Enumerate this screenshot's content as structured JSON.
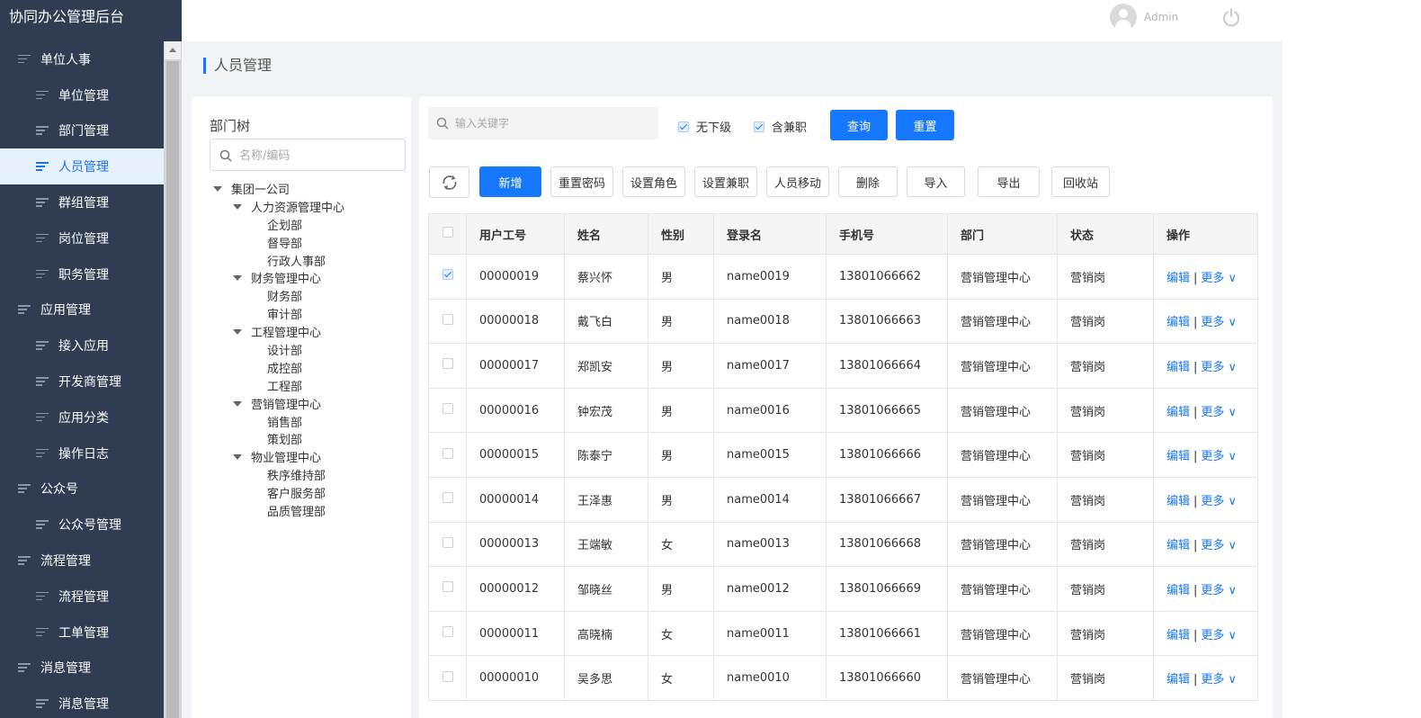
{
  "app": {
    "title": "协同办公管理后台",
    "user": "Admin"
  },
  "sidebar": {
    "items": [
      {
        "label": "单位人事",
        "level": "group"
      },
      {
        "label": "单位管理",
        "level": "sub"
      },
      {
        "label": "部门管理",
        "level": "sub"
      },
      {
        "label": "人员管理",
        "level": "sub",
        "active": true
      },
      {
        "label": "群组管理",
        "level": "sub"
      },
      {
        "label": "岗位管理",
        "level": "sub"
      },
      {
        "label": "职务管理",
        "level": "sub"
      },
      {
        "label": "应用管理",
        "level": "group"
      },
      {
        "label": "接入应用",
        "level": "sub"
      },
      {
        "label": "开发商管理",
        "level": "sub"
      },
      {
        "label": "应用分类",
        "level": "sub"
      },
      {
        "label": "操作日志",
        "level": "sub"
      },
      {
        "label": "公众号",
        "level": "group"
      },
      {
        "label": "公众号管理",
        "level": "sub"
      },
      {
        "label": "流程管理",
        "level": "group"
      },
      {
        "label": "流程管理",
        "level": "sub"
      },
      {
        "label": "工单管理",
        "level": "sub"
      },
      {
        "label": "消息管理",
        "level": "group"
      },
      {
        "label": "消息管理",
        "level": "sub"
      }
    ]
  },
  "page": {
    "title": "人员管理"
  },
  "tree": {
    "title": "部门树",
    "search_placeholder": "名称/编码",
    "nodes": [
      {
        "label": "集团一公司",
        "level": 1,
        "expanded": true
      },
      {
        "label": "人力资源管理中心",
        "level": 2,
        "expanded": true
      },
      {
        "label": "企划部",
        "level": 3
      },
      {
        "label": "督导部",
        "level": 3
      },
      {
        "label": "行政人事部",
        "level": 3
      },
      {
        "label": "财务管理中心",
        "level": 2,
        "expanded": true
      },
      {
        "label": "财务部",
        "level": 3
      },
      {
        "label": "审计部",
        "level": 3
      },
      {
        "label": "工程管理中心",
        "level": 2,
        "expanded": true
      },
      {
        "label": "设计部",
        "level": 3
      },
      {
        "label": "成控部",
        "level": 3
      },
      {
        "label": "工程部",
        "level": 3
      },
      {
        "label": "营销管理中心",
        "level": 2,
        "expanded": true
      },
      {
        "label": "销售部",
        "level": 3
      },
      {
        "label": "策划部",
        "level": 3
      },
      {
        "label": "物业管理中心",
        "level": 2,
        "expanded": true
      },
      {
        "label": "秩序维持部",
        "level": 3
      },
      {
        "label": "客户服务部",
        "level": 3
      },
      {
        "label": "品质管理部",
        "level": 3
      }
    ]
  },
  "filters": {
    "keyword_placeholder": "输入关键字",
    "no_sublevel": {
      "label": "无下级",
      "checked": true
    },
    "include_parttime": {
      "label": "含兼职",
      "checked": true
    },
    "query_label": "查询",
    "reset_label": "重置"
  },
  "toolbar": {
    "add": "新增",
    "reset_password": "重置密码",
    "set_role": "设置角色",
    "set_parttime": "设置兼职",
    "move": "人员移动",
    "delete": "删除",
    "import": "导入",
    "export": "导出",
    "recycle": "回收站"
  },
  "table": {
    "headers": [
      "用户工号",
      "姓名",
      "性别",
      "登录名",
      "手机号",
      "部门",
      "状态",
      "操作"
    ],
    "edit_label": "编辑",
    "more_label": "更多 ∨",
    "rows": [
      {
        "id": "00000019",
        "name": "蔡兴怀",
        "gender": "男",
        "login": "name0019",
        "phone": "13801066662",
        "dept": "营销管理中心",
        "status": "营销岗",
        "checked": true
      },
      {
        "id": "00000018",
        "name": "戴飞白",
        "gender": "男",
        "login": "name0018",
        "phone": "13801066663",
        "dept": "营销管理中心",
        "status": "营销岗"
      },
      {
        "id": "00000017",
        "name": "郑凯安",
        "gender": "男",
        "login": "name0017",
        "phone": "13801066664",
        "dept": "营销管理中心",
        "status": "营销岗"
      },
      {
        "id": "00000016",
        "name": "钟宏茂",
        "gender": "男",
        "login": "name0016",
        "phone": "13801066665",
        "dept": "营销管理中心",
        "status": "营销岗"
      },
      {
        "id": "00000015",
        "name": "陈泰宁",
        "gender": "男",
        "login": "name0015",
        "phone": "13801066666",
        "dept": "营销管理中心",
        "status": "营销岗"
      },
      {
        "id": "00000014",
        "name": "王泽惠",
        "gender": "男",
        "login": "name0014",
        "phone": "13801066667",
        "dept": "营销管理中心",
        "status": "营销岗"
      },
      {
        "id": "00000013",
        "name": "王端敏",
        "gender": "女",
        "login": "name0013",
        "phone": "13801066668",
        "dept": "营销管理中心",
        "status": "营销岗"
      },
      {
        "id": "00000012",
        "name": "邹晓丝",
        "gender": "男",
        "login": "name0012",
        "phone": "13801066669",
        "dept": "营销管理中心",
        "status": "营销岗"
      },
      {
        "id": "00000011",
        "name": "高晓楠",
        "gender": "女",
        "login": "name0011",
        "phone": "13801066661",
        "dept": "营销管理中心",
        "status": "营销岗"
      },
      {
        "id": "00000010",
        "name": "吴多思",
        "gender": "女",
        "login": "name0010",
        "phone": "13801066660",
        "dept": "营销管理中心",
        "status": "营销岗"
      }
    ]
  },
  "colors": {
    "primary": "#1677ff",
    "sidebar_bg": "#2f3c52",
    "active_bg": "#e8f2ff"
  }
}
